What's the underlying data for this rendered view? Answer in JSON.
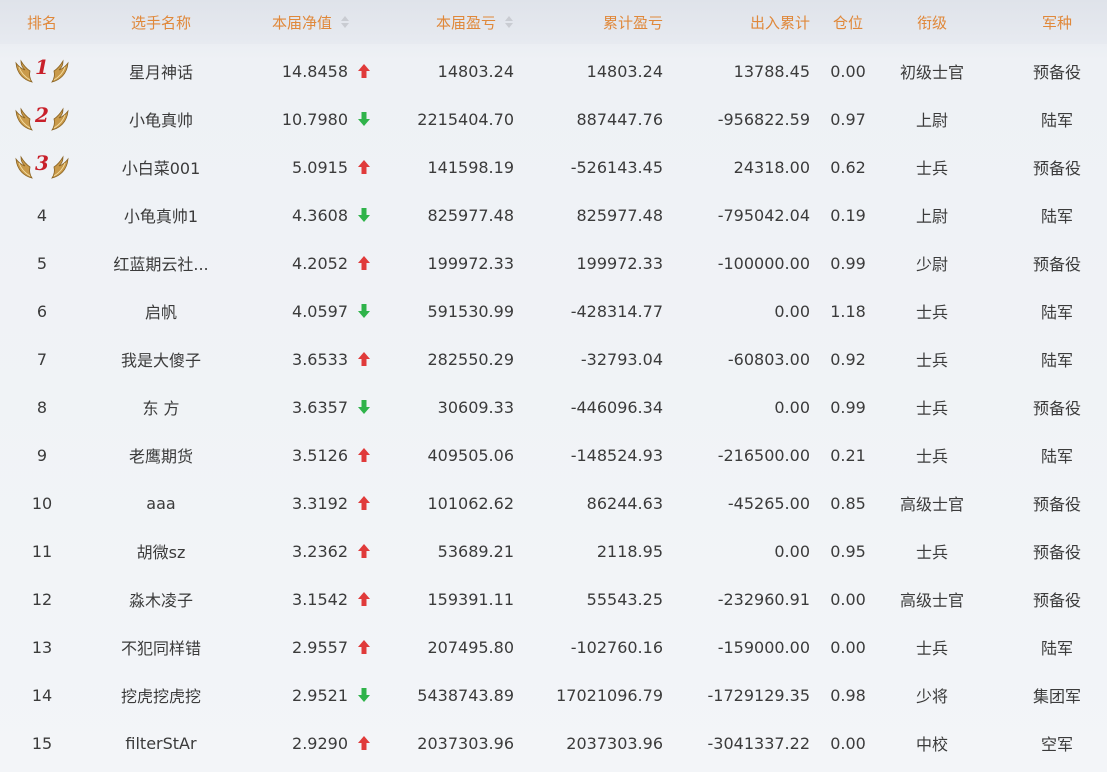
{
  "header": {
    "rank": "排名",
    "name": "选手名称",
    "nav": "本届净值",
    "profit": "本届盈亏",
    "cumulative": "累计盈亏",
    "flow": "出入累计",
    "position": "仓位",
    "military_rank": "衔级",
    "army": "军种"
  },
  "colors": {
    "header_text": "#e0883a",
    "up": "#e03a3a",
    "down": "#2fb34a",
    "medal_number": "#c8202a"
  },
  "rows": [
    {
      "rank": "1",
      "medal": true,
      "name": "星月神话",
      "nav": "14.8458",
      "trend": "up",
      "profit": "14803.24",
      "cumulative": "14803.24",
      "flow": "13788.45",
      "position": "0.00",
      "military_rank": "初级士官",
      "army": "预备役"
    },
    {
      "rank": "2",
      "medal": true,
      "name": "小龟真帅",
      "nav": "10.7980",
      "trend": "down",
      "profit": "2215404.70",
      "cumulative": "887447.76",
      "flow": "-956822.59",
      "position": "0.97",
      "military_rank": "上尉",
      "army": "陆军"
    },
    {
      "rank": "3",
      "medal": true,
      "name": "小白菜001",
      "nav": "5.0915",
      "trend": "up",
      "profit": "141598.19",
      "cumulative": "-526143.45",
      "flow": "24318.00",
      "position": "0.62",
      "military_rank": "士兵",
      "army": "预备役"
    },
    {
      "rank": "4",
      "medal": false,
      "name": "小龟真帅1",
      "nav": "4.3608",
      "trend": "down",
      "profit": "825977.48",
      "cumulative": "825977.48",
      "flow": "-795042.04",
      "position": "0.19",
      "military_rank": "上尉",
      "army": "陆军"
    },
    {
      "rank": "5",
      "medal": false,
      "name": "红蓝期云社...",
      "nav": "4.2052",
      "trend": "up",
      "profit": "199972.33",
      "cumulative": "199972.33",
      "flow": "-100000.00",
      "position": "0.99",
      "military_rank": "少尉",
      "army": "预备役"
    },
    {
      "rank": "6",
      "medal": false,
      "name": "启帆",
      "nav": "4.0597",
      "trend": "down",
      "profit": "591530.99",
      "cumulative": "-428314.77",
      "flow": "0.00",
      "position": "1.18",
      "military_rank": "士兵",
      "army": "陆军"
    },
    {
      "rank": "7",
      "medal": false,
      "name": "我是大傻子",
      "nav": "3.6533",
      "trend": "up",
      "profit": "282550.29",
      "cumulative": "-32793.04",
      "flow": "-60803.00",
      "position": "0.92",
      "military_rank": "士兵",
      "army": "陆军"
    },
    {
      "rank": "8",
      "medal": false,
      "name": "东 方",
      "nav": "3.6357",
      "trend": "down",
      "profit": "30609.33",
      "cumulative": "-446096.34",
      "flow": "0.00",
      "position": "0.99",
      "military_rank": "士兵",
      "army": "预备役"
    },
    {
      "rank": "9",
      "medal": false,
      "name": "老鹰期货",
      "nav": "3.5126",
      "trend": "up",
      "profit": "409505.06",
      "cumulative": "-148524.93",
      "flow": "-216500.00",
      "position": "0.21",
      "military_rank": "士兵",
      "army": "陆军"
    },
    {
      "rank": "10",
      "medal": false,
      "name": "aaa",
      "nav": "3.3192",
      "trend": "up",
      "profit": "101062.62",
      "cumulative": "86244.63",
      "flow": "-45265.00",
      "position": "0.85",
      "military_rank": "高级士官",
      "army": "预备役"
    },
    {
      "rank": "11",
      "medal": false,
      "name": "胡微sz",
      "nav": "3.2362",
      "trend": "up",
      "profit": "53689.21",
      "cumulative": "2118.95",
      "flow": "0.00",
      "position": "0.95",
      "military_rank": "士兵",
      "army": "预备役"
    },
    {
      "rank": "12",
      "medal": false,
      "name": "淼木凌子",
      "nav": "3.1542",
      "trend": "up",
      "profit": "159391.11",
      "cumulative": "55543.25",
      "flow": "-232960.91",
      "position": "0.00",
      "military_rank": "高级士官",
      "army": "预备役"
    },
    {
      "rank": "13",
      "medal": false,
      "name": "不犯同样错",
      "nav": "2.9557",
      "trend": "up",
      "profit": "207495.80",
      "cumulative": "-102760.16",
      "flow": "-159000.00",
      "position": "0.00",
      "military_rank": "士兵",
      "army": "陆军"
    },
    {
      "rank": "14",
      "medal": false,
      "name": "挖虎挖虎挖",
      "nav": "2.9521",
      "trend": "down",
      "profit": "5438743.89",
      "cumulative": "17021096.79",
      "flow": "-1729129.35",
      "position": "0.98",
      "military_rank": "少将",
      "army": "集团军"
    },
    {
      "rank": "15",
      "medal": false,
      "name": "filterStAr",
      "nav": "2.9290",
      "trend": "up",
      "profit": "2037303.96",
      "cumulative": "2037303.96",
      "flow": "-3041337.22",
      "position": "0.00",
      "military_rank": "中校",
      "army": "空军"
    }
  ]
}
